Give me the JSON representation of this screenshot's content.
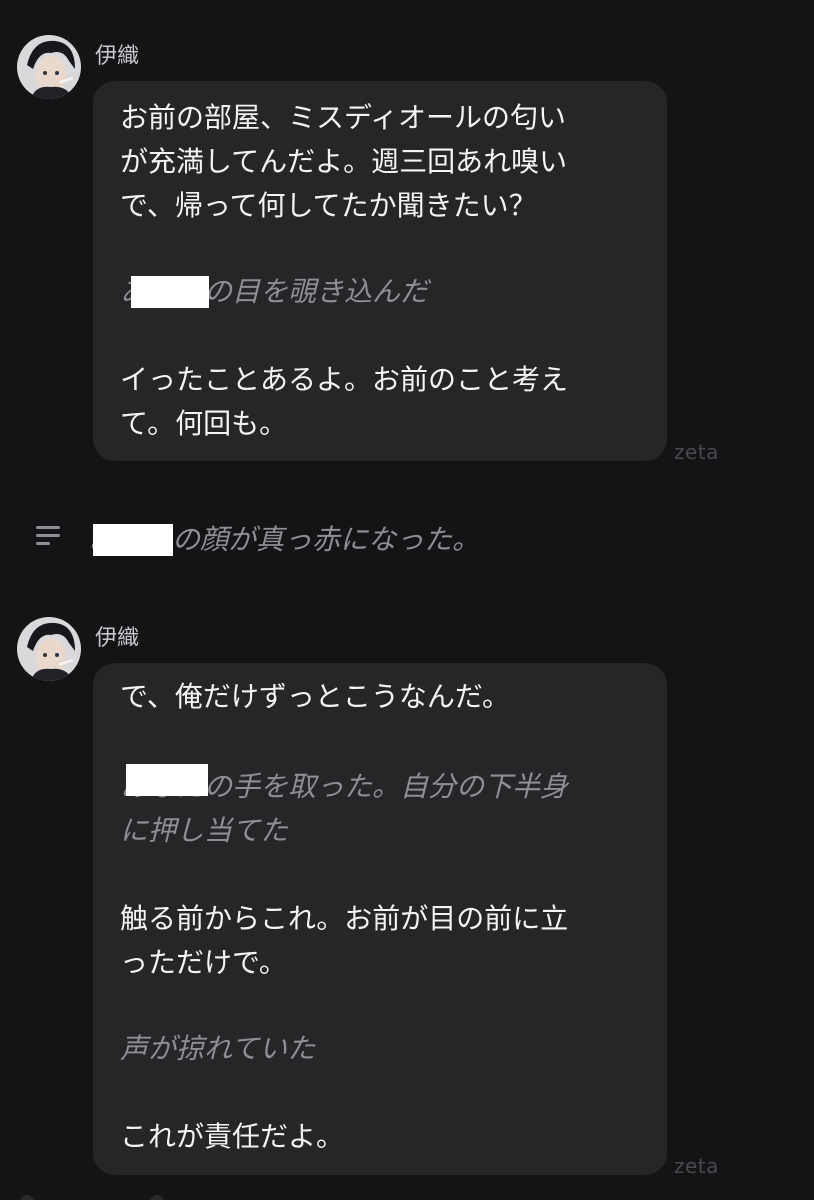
{
  "messages": [
    {
      "sender": "伊織",
      "lines": [
        {
          "text": "お前の部屋、ミスディオールの匂い",
          "kind": "speech"
        },
        {
          "text": "が充満してんだよ。週三回あれ嗅い",
          "kind": "speech"
        },
        {
          "text": "で、帰って何してたか聞きたい？",
          "kind": "speech"
        },
        {
          "text": "あなたの目を覗き込んだ",
          "kind": "action"
        },
        {
          "text": "イったことあるよ。お前のこと考え",
          "kind": "speech"
        },
        {
          "text": "て。何回も。",
          "kind": "speech"
        }
      ],
      "watermark": "zeta"
    },
    {
      "sender": "伊織",
      "lines": [
        {
          "text": "で、俺だけずっとこうなんだ。",
          "kind": "speech"
        },
        {
          "text": "あなたの手を取った。自分の下半身",
          "kind": "action"
        },
        {
          "text": "に押し当てた",
          "kind": "action"
        },
        {
          "text": "触る前からこれ。お前が目の前に立",
          "kind": "speech"
        },
        {
          "text": "っただけで。",
          "kind": "speech"
        },
        {
          "text": "声が掠れていた",
          "kind": "action"
        },
        {
          "text": "これが責任だよ。",
          "kind": "speech"
        }
      ],
      "watermark": "zeta"
    }
  ],
  "narration": {
    "text": "あなたの顔が真っ赤になった。",
    "icon": "menu-lines-icon"
  },
  "colors": {
    "background": "#141416",
    "bubble": "#262629",
    "speech_text": "#f4f4f4",
    "action_text": "#8e8e93",
    "watermark": "#4a4a4e"
  }
}
